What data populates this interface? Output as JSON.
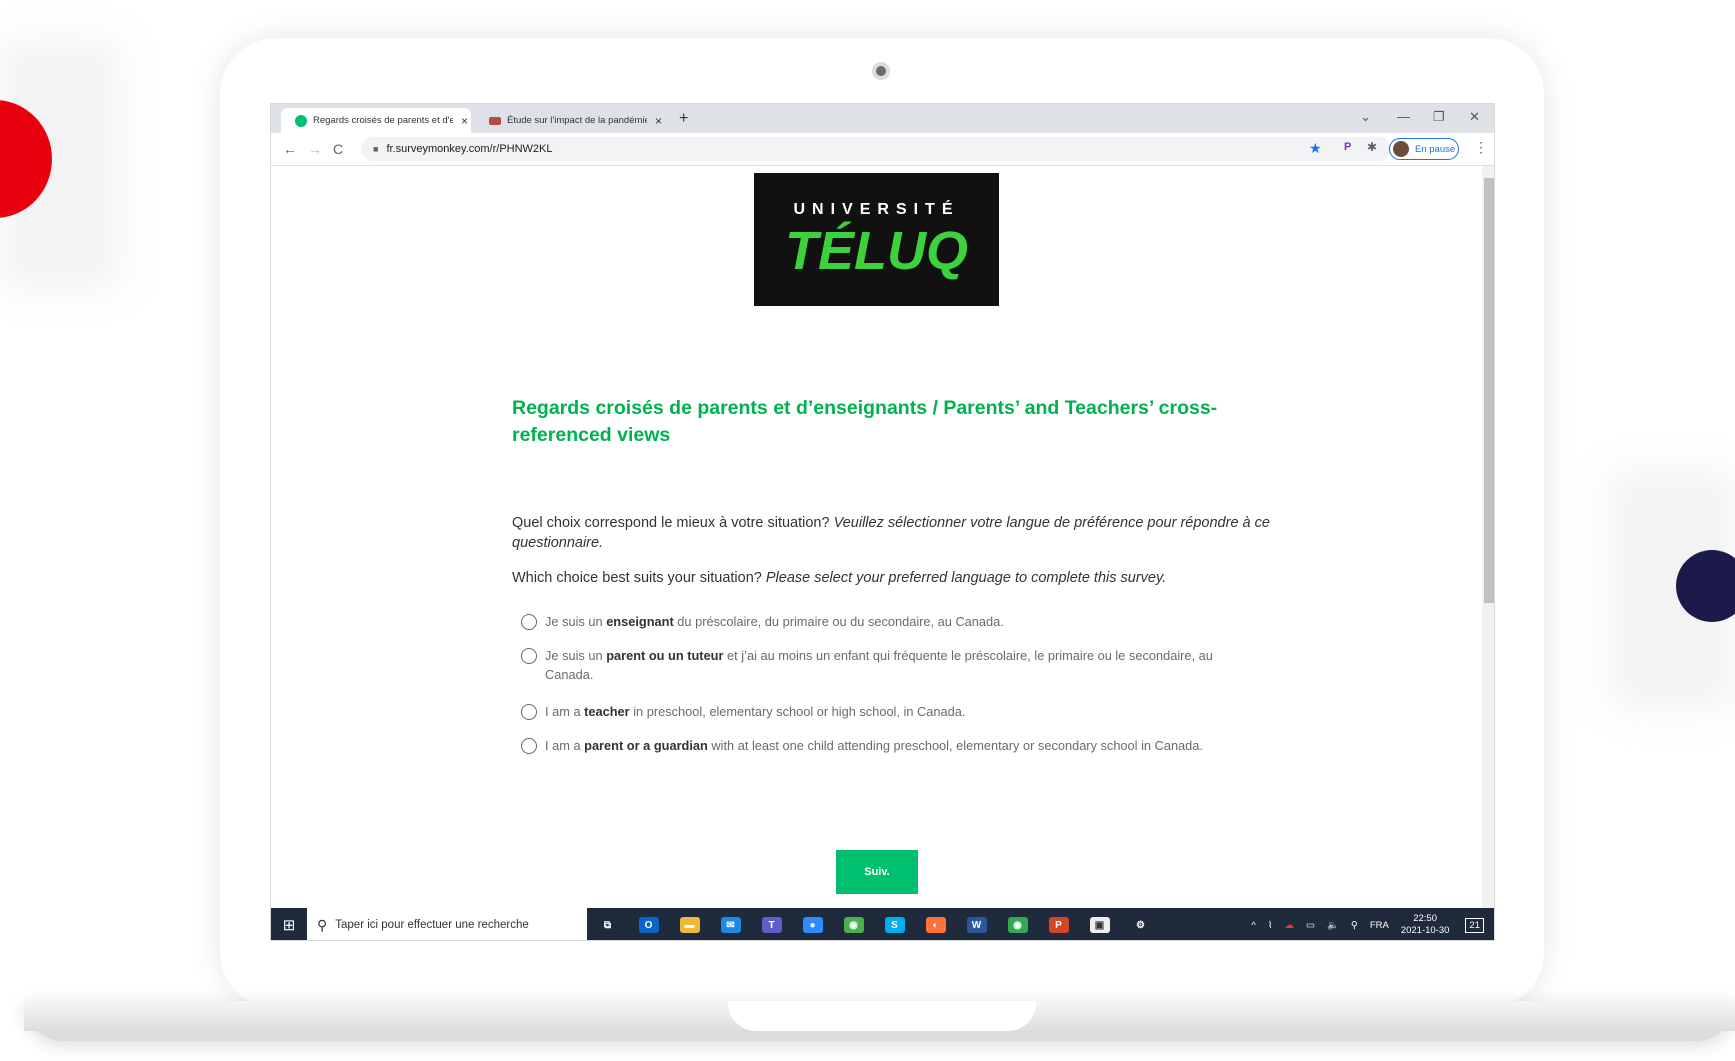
{
  "browser": {
    "tabs": [
      {
        "label": "Regards croisés de parents et d'enseignants",
        "active": true
      },
      {
        "label": "Étude sur l'impact de la pandémie",
        "active": false
      }
    ],
    "close_glyph": "×",
    "new_tab_glyph": "+",
    "url": "fr.surveymonkey.com/r/PHNW2KL",
    "profile_label": "En pause",
    "window_controls": [
      "⌄",
      "—",
      "❐",
      "✕"
    ],
    "nav_icons": [
      "←",
      "→",
      "C"
    ]
  },
  "logo": {
    "line1": "UNIVERSITÉ",
    "line2": "TÉLUQ"
  },
  "survey": {
    "title": "Regards croisés de parents et d’enseignants / Parents’ and Teachers’ cross-referenced views",
    "question_fr": "Quel choix correspond le mieux à votre situation?",
    "question_fr_italic": "Veuillez sélectionner votre langue de préférence pour répondre à ce questionnaire.",
    "question_en": "Which choice best suits your situation?",
    "question_en_italic": "Please select your preferred language to complete this survey.",
    "options": [
      {
        "pre": "Je suis un ",
        "bold": "enseignant",
        "post": " du préscolaire, du primaire ou du secondaire, au Canada."
      },
      {
        "pre": "Je suis un ",
        "bold": "parent ou un tuteur",
        "post": " et j’ai au moins un enfant qui fréquente le préscolaire, le primaire ou le secondaire, au Canada."
      },
      {
        "pre": "I am a ",
        "bold": "teacher",
        "post": " in preschool, elementary school or high school, in Canada."
      },
      {
        "pre": "I am a ",
        "bold": "parent or a guardian",
        "post": " with at least one child attending preschool, elementary or secondary school in Canada."
      }
    ],
    "next_button": "Suiv."
  },
  "taskbar": {
    "search_placeholder": "Taper ici pour effectuer une recherche",
    "apps": [
      {
        "name": "task-view",
        "glyph": "⧉",
        "color": "#1f2b3d"
      },
      {
        "name": "outlook",
        "glyph": "O",
        "color": "#0a64c9"
      },
      {
        "name": "file-explorer",
        "glyph": "▬",
        "color": "#f0b83a"
      },
      {
        "name": "mail",
        "glyph": "✉",
        "color": "#1e88e5"
      },
      {
        "name": "teams",
        "glyph": "T",
        "color": "#5b5fc7"
      },
      {
        "name": "zoom",
        "glyph": "●",
        "color": "#2d8cff"
      },
      {
        "name": "chrome",
        "glyph": "◉",
        "color": "#4caf50"
      },
      {
        "name": "skype",
        "glyph": "S",
        "color": "#00aff0"
      },
      {
        "name": "firefox",
        "glyph": "◐",
        "color": "#ff7139"
      },
      {
        "name": "word",
        "glyph": "W",
        "color": "#2b579a"
      },
      {
        "name": "chrome-alt",
        "glyph": "◉",
        "color": "#34a853"
      },
      {
        "name": "powerpoint",
        "glyph": "P",
        "color": "#d24726"
      },
      {
        "name": "store",
        "glyph": "▣",
        "color": "#eeeeee"
      },
      {
        "name": "settings",
        "glyph": "⚙",
        "color": "#1f2b3d"
      }
    ],
    "tray_icons": [
      "^",
      "⌇",
      "☁",
      "▭",
      "🔈",
      "⚲"
    ],
    "language": "FRA",
    "time": "22:50",
    "date": "2021-10-30",
    "notification_count": "21"
  },
  "colors": {
    "accent_green": "#00bf6f",
    "title_green": "#00b24f",
    "logo_green": "#3ed13e",
    "red_blob": "#e8000f",
    "navy_blob": "#1c1a4a"
  }
}
